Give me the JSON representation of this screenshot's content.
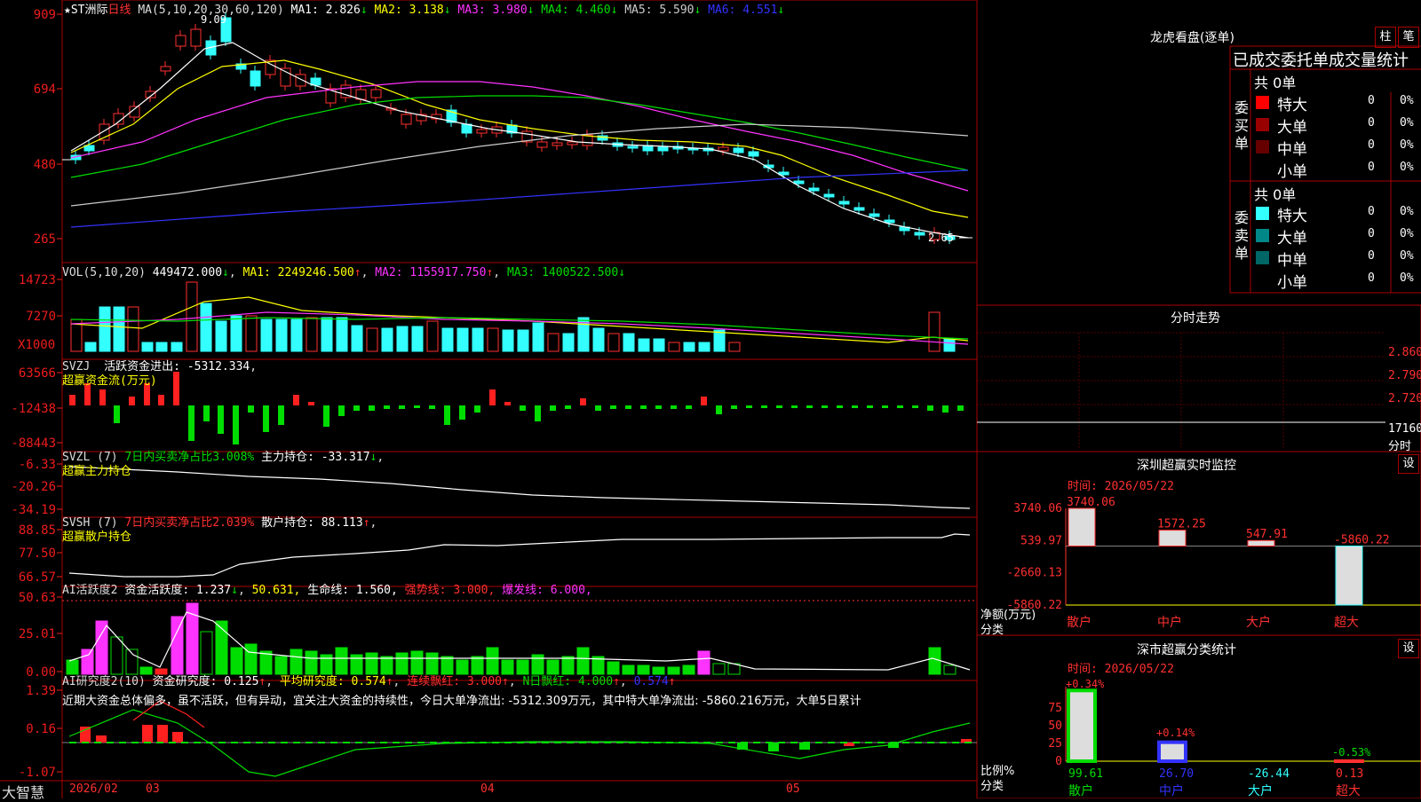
{
  "colors": {
    "red": "#ff3030",
    "cyan": "#33ffff",
    "white": "#ffffff",
    "yellow": "#ffff00",
    "magenta": "#ff33ff",
    "green": "#00dd00",
    "blue": "#3333ff",
    "gray": "#aaaaaa",
    "frame": "#aa0000",
    "axis": "#dd2020"
  },
  "main": {
    "title": "★ST洲际",
    "period": "日线",
    "ma_label": "MA(5,10,20,30,60,120)",
    "ma": [
      {
        "label": "MA1:",
        "value": "2.826",
        "arrow": "↓",
        "color": "#ffffff"
      },
      {
        "label": "MA2:",
        "value": "3.138",
        "arrow": "↓",
        "color": "#ffff00"
      },
      {
        "label": "MA3:",
        "value": "3.980",
        "arrow": "↓",
        "color": "#ff33ff"
      },
      {
        "label": "MA4:",
        "value": "4.460",
        "arrow": "↓",
        "color": "#00dd00"
      },
      {
        "label": "MA5:",
        "value": "5.590",
        "arrow": "↓",
        "color": "#cccccc"
      },
      {
        "label": "MA6:",
        "value": "4.551",
        "arrow": "↓",
        "color": "#3333ff"
      }
    ],
    "yticks": [
      "909",
      "694",
      "480",
      "265"
    ],
    "high_label": "9.09",
    "low_label": "2.65"
  },
  "vol": {
    "label": "VOL(5,10,20)",
    "value": "449472.000",
    "ma1": "MA1: 2249246.500",
    "ma2": "MA2: 1155917.750",
    "ma3": "MA3: 1400522.500",
    "yticks": [
      "14723",
      "7270"
    ],
    "unit": "X1000"
  },
  "svzj": {
    "label": "SVZJ",
    "text": "活跃资金进出: -5312.334",
    "sub": "超赢资金流(万元)",
    "yticks": [
      "63566",
      "-12438",
      "-88443"
    ]
  },
  "svzl": {
    "label": "SVZL (7)",
    "t1": "7日内买卖净占比3.008%",
    "t2": "主力持仓: -33.317",
    "sub": "超赢主力持仓",
    "yticks": [
      "-6.33",
      "-20.26",
      "-34.19"
    ]
  },
  "svsh": {
    "label": "SVSH (7)",
    "t1": "7日内买卖净占比2.039%",
    "t2": "散户持仓: 88.113",
    "sub": "超赢散户持仓",
    "yticks": [
      "88.85",
      "77.50",
      "66.57"
    ]
  },
  "ai1": {
    "label": "AI活跃度2",
    "t1": "资金活跃度: 1.237",
    "t2": "50.631,",
    "t3": "生命线: 1.560,",
    "t4": "强势线: 3.000,",
    "t5": "爆发线: 6.000,",
    "yticks": [
      "50.63",
      "25.01",
      "0.00"
    ]
  },
  "ai2": {
    "label": "AI研究度2(10)",
    "t1": "资金研究度: 0.125",
    "t2": "平均研究度: 0.574",
    "t3": "连续飘红: 3.000",
    "t4": "N日飘红: 4.000",
    "t5": "0.574",
    "comment": "近期大资金总体偏多，虽不活跃，但有异动，宜关注大资金的持续性，今日大单净流出: -5312.309万元，其中特大单净流出: -5860.216万元，大单5日累计",
    "yticks": [
      "1.39",
      "0.16",
      "-1.07"
    ]
  },
  "xaxis": {
    "brand": "大智慧",
    "labels": [
      "2026/02",
      "03",
      "04",
      "05"
    ]
  },
  "dragon": {
    "title": "龙虎看盘(逐单)",
    "btn1": "柱",
    "btn2": "笔",
    "header": "已成交委托单成交量统计",
    "buy": {
      "side": "委买单",
      "count": "共 0单",
      "rows": [
        {
          "name": "特大",
          "value": "0",
          "pct": "0%",
          "color": "#ff0000"
        },
        {
          "name": "大单",
          "value": "0",
          "pct": "0%",
          "color": "#990000"
        },
        {
          "name": "中单",
          "value": "0",
          "pct": "0%",
          "color": "#660000"
        },
        {
          "name": "小单",
          "value": "0",
          "pct": "0%",
          "color": "#000000"
        }
      ]
    },
    "sell": {
      "side": "委卖单",
      "count": "共 0单",
      "rows": [
        {
          "name": "特大",
          "value": "0",
          "pct": "0%",
          "color": "#33ffff"
        },
        {
          "name": "大单",
          "value": "0",
          "pct": "0%",
          "color": "#008888"
        },
        {
          "name": "中单",
          "value": "0",
          "pct": "0%",
          "color": "#006666"
        },
        {
          "name": "小单",
          "value": "0",
          "pct": "0%",
          "color": "#000000"
        }
      ]
    }
  },
  "intraday": {
    "title": "分时走势",
    "yticks": [
      "2.860",
      "2.790",
      "2.720",
      "17160"
    ],
    "bottom": "分时"
  },
  "monitor": {
    "title": "深圳超赢实时监控",
    "btn": "设",
    "date": "时间: 2026/05/22",
    "ylabel": "净额(万元)",
    "xlabel": "分类",
    "yticks": [
      "3740.06",
      "539.97",
      "-2660.13",
      "-5860.22"
    ]
  },
  "classify": {
    "title": "深市超赢分类统计",
    "btn": "设",
    "date": "时间: 2026/05/22",
    "ylabel": "比例%",
    "xlabel": "分类",
    "yticks": [
      "75",
      "50",
      "25",
      "0"
    ]
  },
  "chart_data": [
    {
      "type": "bar",
      "title": "深圳超赢实时监控",
      "categories": [
        "散户",
        "中户",
        "大户",
        "超大"
      ],
      "values": [
        3740.06,
        1572.25,
        547.91,
        -5860.22
      ],
      "ylabel": "净额(万元)",
      "ylim": [
        -5860.22,
        3740.06
      ]
    },
    {
      "type": "bar",
      "title": "深市超赢分类统计",
      "categories": [
        "散户",
        "中户",
        "大户",
        "超大"
      ],
      "series": [
        {
          "values": [
            99.61,
            26.7,
            -26.44,
            0.13
          ]
        },
        {
          "values": [
            0.34,
            0.14,
            null,
            -0.53
          ]
        }
      ],
      "ylabel": "比例%",
      "ylim": [
        0,
        100
      ]
    }
  ]
}
